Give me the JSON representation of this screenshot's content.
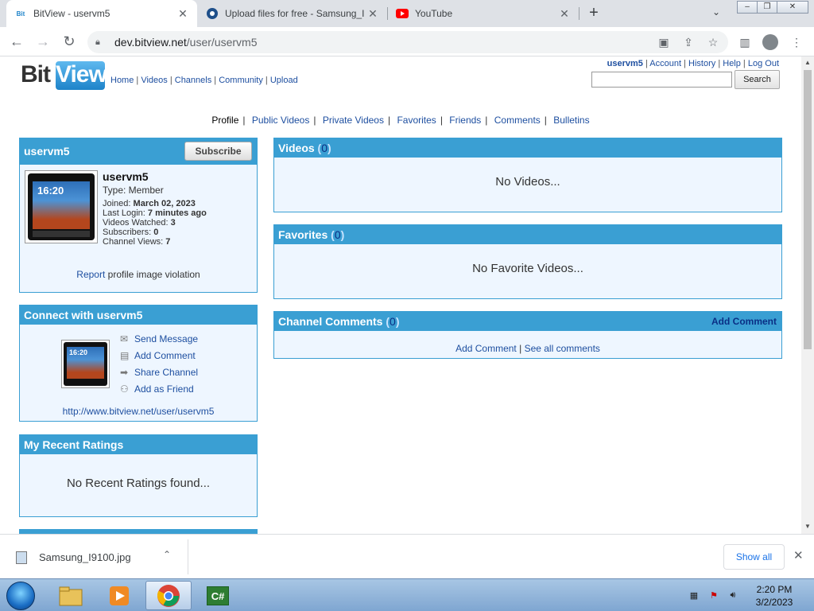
{
  "browser": {
    "tabs": [
      {
        "title": "BitView - uservm5",
        "favicon": "bitview-icon",
        "active": true
      },
      {
        "title": "Upload files for free - Samsung_I",
        "favicon": "upload-cloud-icon",
        "active": false
      },
      {
        "title": "YouTube",
        "favicon": "youtube-icon",
        "active": false
      }
    ],
    "new_tab": "+",
    "url_host": "dev.bitview.net",
    "url_path": "/user/uservm5"
  },
  "site": {
    "logo_bit": "Bit",
    "logo_view": "View",
    "nav": [
      "Home",
      "Videos",
      "Channels",
      "Community",
      "Upload"
    ],
    "user_links": {
      "username": "uservm5",
      "account": "Account",
      "history": "History",
      "help": "Help",
      "logout": "Log Out"
    },
    "search": {
      "placeholder": "",
      "button": "Search"
    }
  },
  "profile_nav": {
    "current": "Profile",
    "links": [
      "Public Videos",
      "Private Videos",
      "Favorites",
      "Friends",
      "Comments",
      "Bulletins"
    ]
  },
  "profile": {
    "title": "uservm5",
    "subscribe": "Subscribe",
    "name": "uservm5",
    "type": "Type: Member",
    "joined_label": "Joined:",
    "joined": "March 02, 2023",
    "last_login_label": "Last Login:",
    "last_login": "7 minutes ago",
    "watched_label": "Videos Watched:",
    "watched": "3",
    "subs_label": "Subscribers:",
    "subs": "0",
    "views_label": "Channel Views:",
    "views": "7",
    "report_link": "Report",
    "report_text": " profile image violation",
    "phone_time": "16:20"
  },
  "connect": {
    "title": "Connect with uservm5",
    "items": [
      "Send Message",
      "Add Comment",
      "Share Channel",
      "Add as Friend"
    ],
    "channel_url": "http://www.bitview.net/user/uservm5"
  },
  "ratings": {
    "title": "My Recent Ratings",
    "empty": "No Recent Ratings found..."
  },
  "videos": {
    "title": "Videos",
    "count": "0",
    "empty": "No Videos..."
  },
  "favorites": {
    "title": "Favorites",
    "count": "0",
    "empty": "No Favorite Videos..."
  },
  "comments": {
    "title": "Channel Comments",
    "count": "0",
    "add": "Add Comment",
    "add_link": "Add Comment",
    "see_all": "See all comments"
  },
  "download": {
    "file": "Samsung_I9100.jpg",
    "show_all": "Show all"
  },
  "taskbar": {
    "time": "2:20 PM",
    "date": "3/2/2023",
    "c_sharp_label": "C#"
  }
}
